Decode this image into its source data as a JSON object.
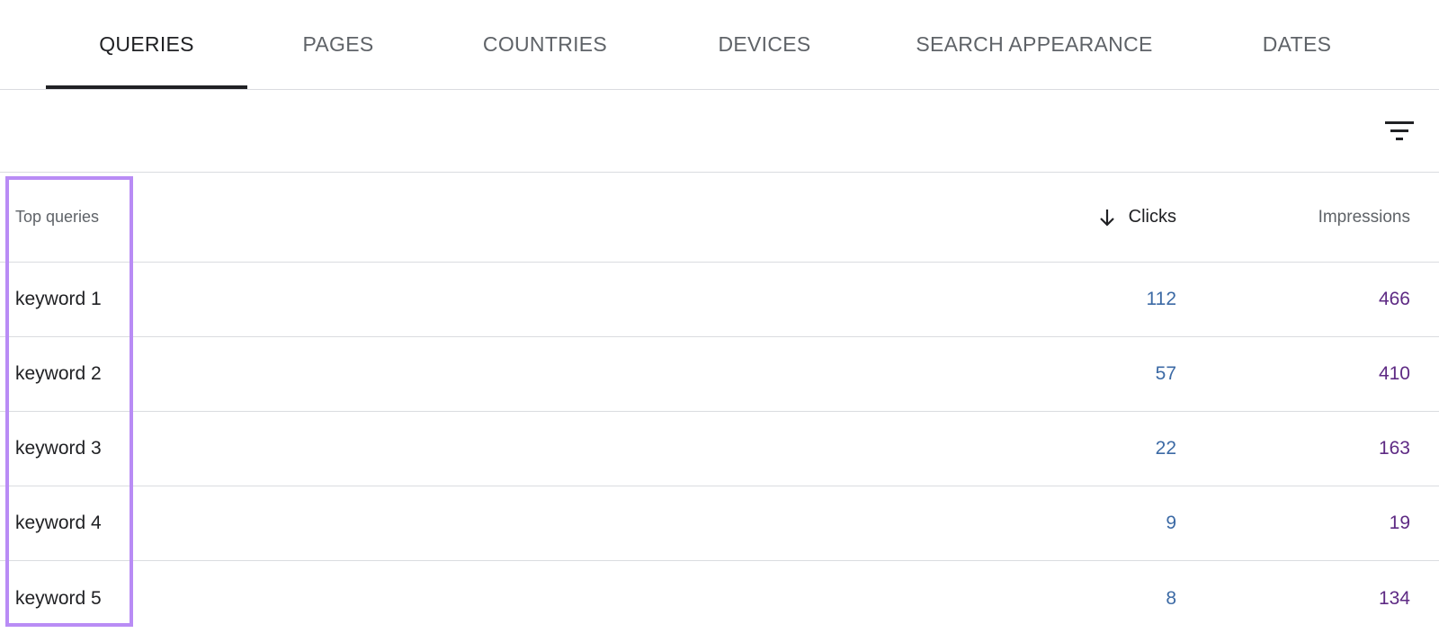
{
  "tabs": [
    {
      "label": "QUERIES",
      "active": true
    },
    {
      "label": "PAGES",
      "active": false
    },
    {
      "label": "COUNTRIES",
      "active": false
    },
    {
      "label": "DEVICES",
      "active": false
    },
    {
      "label": "SEARCH APPEARANCE",
      "active": false
    },
    {
      "label": "DATES",
      "active": false
    }
  ],
  "toolbar": {
    "filter_icon": "filter-icon"
  },
  "table": {
    "headers": {
      "query": "Top queries",
      "clicks": "Clicks",
      "impressions": "Impressions",
      "sort_icon": "arrow-down-icon"
    },
    "rows": [
      {
        "query": "keyword 1",
        "clicks": "112",
        "impressions": "466"
      },
      {
        "query": "keyword 2",
        "clicks": "57",
        "impressions": "410"
      },
      {
        "query": "keyword 3",
        "clicks": "22",
        "impressions": "163"
      },
      {
        "query": "keyword 4",
        "clicks": "9",
        "impressions": "19"
      },
      {
        "query": "keyword 5",
        "clicks": "8",
        "impressions": "134"
      }
    ]
  },
  "colors": {
    "clicks": "#3c6aa5",
    "impressions": "#5e2a84",
    "highlight": "#b98cf5",
    "active_tab": "#202124"
  }
}
